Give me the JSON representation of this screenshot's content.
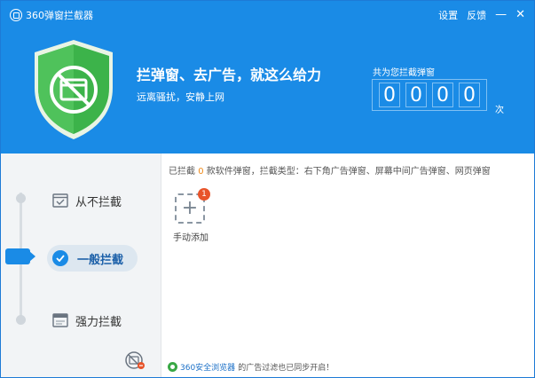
{
  "window": {
    "title": "360弹窗拦截器"
  },
  "controls": {
    "settings": "设置",
    "feedback": "反馈",
    "minimize": "—",
    "close": "✕"
  },
  "header": {
    "slogan": "拦弹窗、去广告，就这么给力",
    "subslogan": "远离骚扰，安静上网",
    "counter_label": "共为您拦截弹窗",
    "digits": [
      "0",
      "0",
      "0",
      "0"
    ],
    "counter_unit": "次"
  },
  "sidebar": {
    "modes": [
      {
        "label": "从不拦截",
        "icon": "checkbox-window-icon"
      },
      {
        "label": "一般拦截",
        "icon": "check-circle-icon",
        "active": true
      },
      {
        "label": "强力拦截",
        "icon": "window-icon"
      }
    ]
  },
  "main": {
    "summary_prefix": "已拦截",
    "summary_count": "0",
    "summary_suffix": "款软件弹窗，拦截类型：右下角广告弹窗、屏幕中间广告弹窗、网页弹窗",
    "add_badge": "1",
    "add_label": "手动添加"
  },
  "footer": {
    "browser_link": "360安全浏览器",
    "message": "的广告过滤也已同步开启！"
  },
  "colors": {
    "header_bg": "#1a8be6",
    "accent_orange": "#ef8a1a",
    "badge_red": "#e8542a",
    "shield_green": "#3cb34a"
  }
}
